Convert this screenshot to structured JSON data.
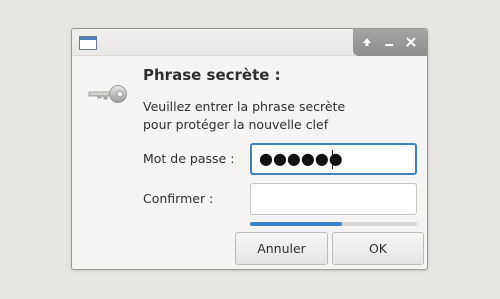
{
  "window": {
    "controls": [
      "up-icon",
      "minimize-icon",
      "close-icon"
    ]
  },
  "dialog": {
    "heading": "Phrase secrète :",
    "description_line1": "Veuillez entrer la phrase secrète",
    "description_line2": "pour protéger la nouvelle clef"
  },
  "form": {
    "password_label": "Mot de passe :",
    "password_value": "●●●●●●",
    "confirm_label": "Confirmer :",
    "confirm_value": ""
  },
  "strength": {
    "fraction": 0.55,
    "color": "#3d82c4"
  },
  "buttons": {
    "cancel_label": "Annuler",
    "ok_label": "OK"
  },
  "icons": {
    "dialog_icon": "key-icon",
    "window_icon": "window-icon"
  }
}
